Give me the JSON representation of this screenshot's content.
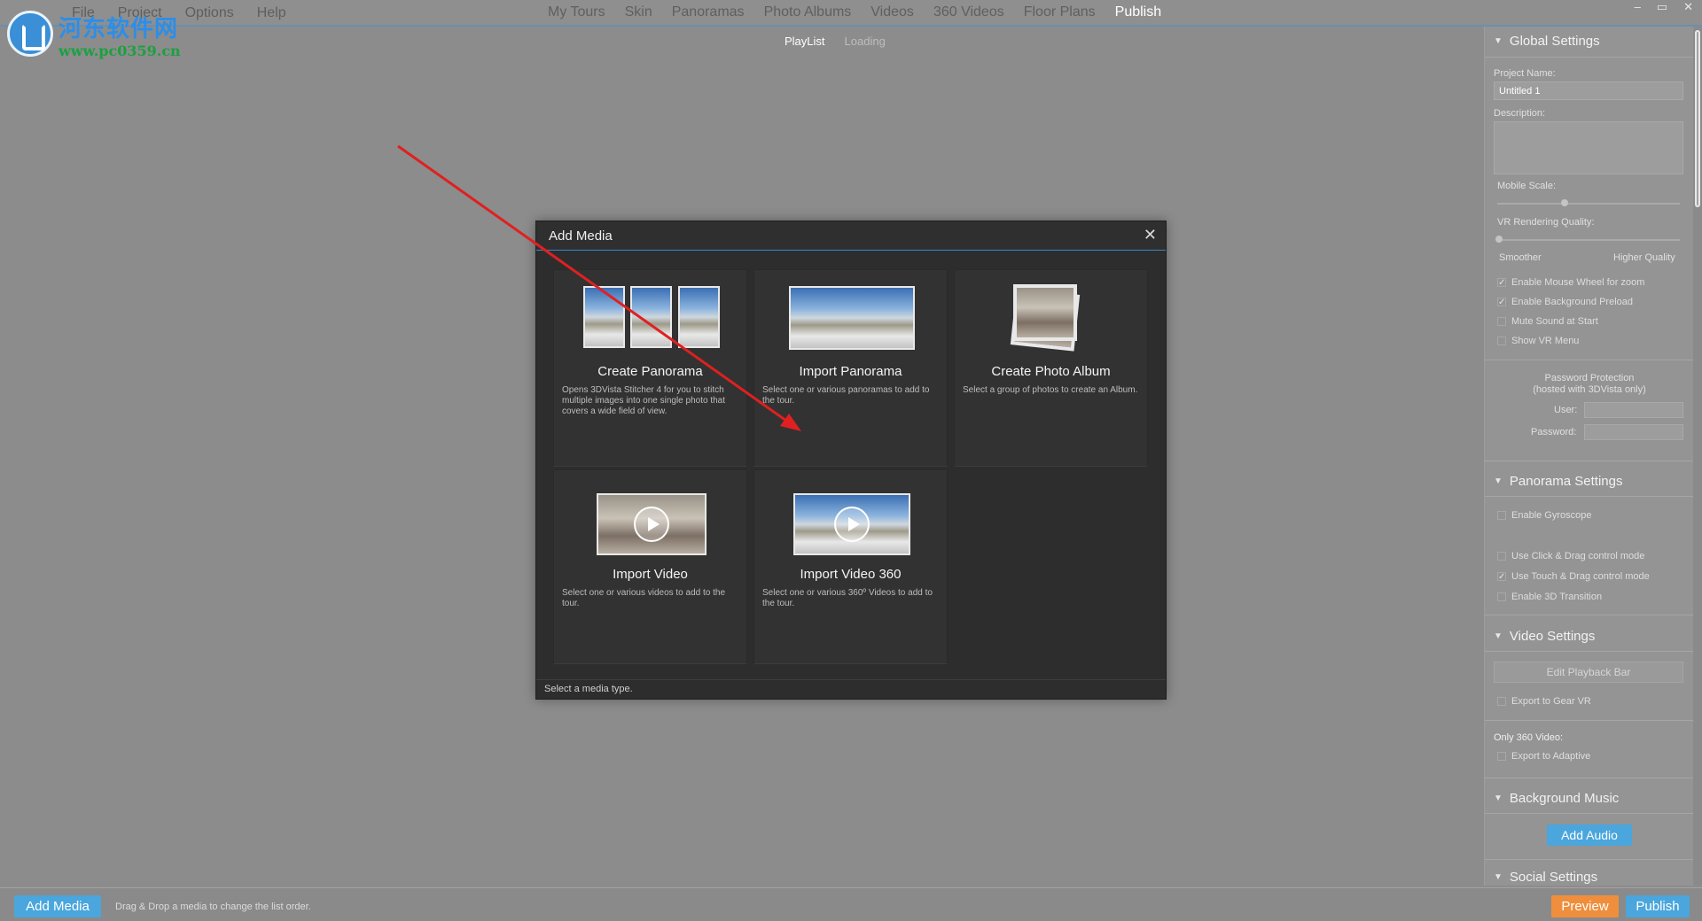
{
  "menu": {
    "left": [
      "File",
      "Project",
      "Options",
      "Help"
    ],
    "center": [
      "My Tours",
      "Skin",
      "Panoramas",
      "Photo Albums",
      "Videos",
      "360 Videos",
      "Floor Plans",
      "Publish"
    ],
    "active_center": "Publish"
  },
  "watermark": {
    "title": "河东软件网",
    "url": "www.pc0359.cn"
  },
  "subtabs": {
    "playlist": "PlayList",
    "loading": "Loading"
  },
  "window_controls": {
    "minimize": "–",
    "restore": "▭",
    "close": "✕"
  },
  "right_panel": {
    "global": {
      "header": "Global Settings",
      "project_name_label": "Project Name:",
      "project_name_value": "Untitled 1",
      "description_label": "Description:",
      "mobile_scale_label": "Mobile Scale:",
      "vr_quality_label": "VR Rendering Quality:",
      "smoother": "Smoother",
      "higher_quality": "Higher Quality",
      "checks": [
        {
          "label": "Enable Mouse Wheel for zoom",
          "checked": true
        },
        {
          "label": "Enable Background Preload",
          "checked": true
        },
        {
          "label": "Mute Sound at Start",
          "checked": false
        },
        {
          "label": "Show VR Menu",
          "checked": false
        }
      ],
      "password_protection": "Password Protection",
      "hosted_note": "(hosted with 3DVista only)",
      "user_label": "User:",
      "password_label": "Password:"
    },
    "panorama": {
      "header": "Panorama Settings",
      "checks": [
        {
          "label": "Enable Gyroscope",
          "checked": false
        },
        {
          "label": "Use Click & Drag control mode",
          "checked": false
        },
        {
          "label": "Use Touch & Drag control mode",
          "checked": true
        },
        {
          "label": "Enable 3D Transition",
          "checked": false
        }
      ]
    },
    "video": {
      "header": "Video Settings",
      "edit_playback": "Edit Playback Bar",
      "export_gear": "Export to Gear VR",
      "only_360": "Only 360 Video:",
      "export_adaptive": "Export to Adaptive"
    },
    "music": {
      "header": "Background Music",
      "add_audio": "Add Audio"
    },
    "social": {
      "header": "Social Settings"
    }
  },
  "bottom": {
    "add_media": "Add Media",
    "hint": "Drag & Drop a media to change the list order.",
    "preview": "Preview",
    "publish": "Publish"
  },
  "modal": {
    "title": "Add Media",
    "close": "✕",
    "footer": "Select a media type.",
    "tiles": [
      {
        "title": "Create Panorama",
        "desc": "Opens 3DVista Stitcher 4 for you to stitch multiple images into one single photo that covers a wide field of view."
      },
      {
        "title": "Import Panorama",
        "desc": "Select one or various panoramas to add to the tour."
      },
      {
        "title": "Create Photo Album",
        "desc": "Select a group of photos to create an Album."
      },
      {
        "title": "Import Video",
        "desc": "Select one or various videos to add to the tour."
      },
      {
        "title": "Import Video 360",
        "desc": "Select one or various 360º Videos to add to the tour."
      }
    ]
  },
  "colors": {
    "accent_blue": "#4aa6dc",
    "preview_orange": "#ef8e3c",
    "annotation_red": "#e02020"
  }
}
